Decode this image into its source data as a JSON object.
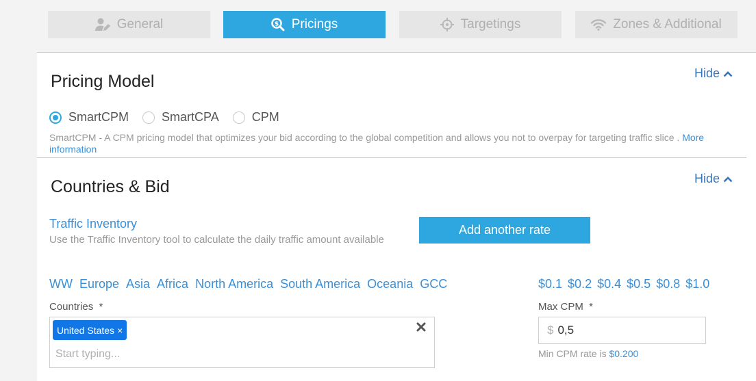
{
  "tabs": [
    {
      "label": "General",
      "icon": "user-edit-icon",
      "active": false
    },
    {
      "label": "Pricings",
      "icon": "search-dollar-icon",
      "active": true
    },
    {
      "label": "Targetings",
      "icon": "crosshair-icon",
      "active": false
    },
    {
      "label": "Zones & Additional",
      "icon": "wifi-icon",
      "active": false
    }
  ],
  "pricing_model": {
    "title": "Pricing Model",
    "hide_label": "Hide",
    "options": [
      "SmartCPM",
      "SmartCPA",
      "CPM"
    ],
    "selected": "SmartCPM",
    "description": "SmartCPM - A CPM pricing model that optimizes your bid according to the global competition and allows you not to overpay for targeting traffic slice .",
    "more_info": "More information"
  },
  "countries_bid": {
    "title": "Countries & Bid",
    "hide_label": "Hide",
    "traffic_inventory_link": "Traffic Inventory",
    "traffic_inventory_desc": "Use the Traffic Inventory tool to calculate the daily traffic amount available",
    "add_rate_button": "Add another rate",
    "regions": [
      "WW",
      "Europe",
      "Asia",
      "Africa",
      "North America",
      "South America",
      "Oceania",
      "GCC"
    ],
    "price_presets": [
      "$0.1",
      "$0.2",
      "$0.4",
      "$0.5",
      "$0.8",
      "$1.0"
    ],
    "countries_label": "Countries  *",
    "selected_countries": [
      "United States"
    ],
    "countries_placeholder": "Start typing...",
    "max_cpm_label": "Max CPM  *",
    "currency_symbol": "$",
    "max_cpm_value": "0,5",
    "min_rate_text": "Min CPM rate is",
    "min_rate_value": "$0.200"
  },
  "colors": {
    "accent": "#2ea7e0",
    "link": "#3a8fd6",
    "tag": "#1177e6"
  }
}
